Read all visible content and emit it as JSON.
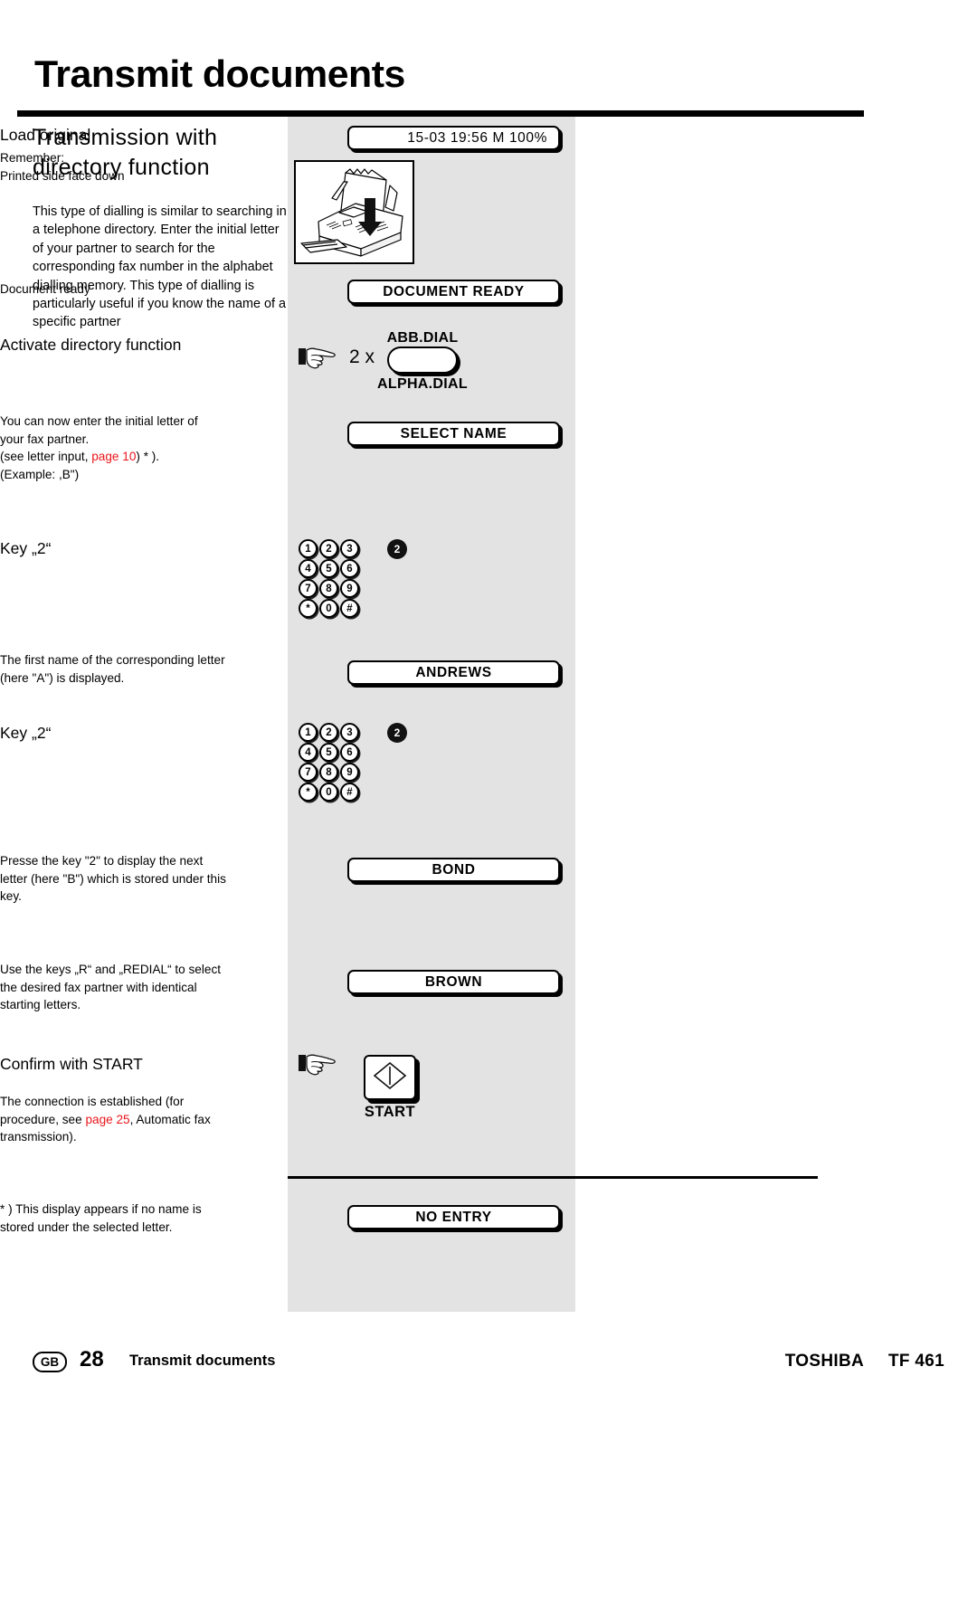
{
  "header": {
    "title": "Transmit documents"
  },
  "left_column": {
    "section_title": "Transmission with directory function",
    "paragraph": "This type of dialling is similar to searching in a telephone directory. Enter the initial letter of your partner to search for the corresponding fax number in the alphabet dialling memory. This type of dialling is particularly useful if you know the name of a specific partner"
  },
  "center_column": {
    "display_status": "15-03 19:56  M 100%",
    "display_document_ready": "DOCUMENT READY",
    "display_select_name": "SELECT NAME",
    "display_andrews": "ANDREWS",
    "display_bond": "BOND",
    "display_brown": "BROWN",
    "display_no_entry": "NO ENTRY",
    "press_count": "2 x",
    "abb_dial_label": "ABB.DIAL",
    "alpha_dial_label": "ALPHA.DIAL",
    "start_label": "START",
    "fax_illustration_alt": "fax-machine-load-original",
    "keypad_rows": [
      [
        "1",
        "2",
        "3"
      ],
      [
        "4",
        "5",
        "6"
      ],
      [
        "7",
        "8",
        "9"
      ],
      [
        "*",
        "0",
        "#"
      ]
    ],
    "keypad_highlight_1": "2",
    "keypad_highlight_2": "2"
  },
  "right_column": {
    "step1_head": "Load original",
    "step1_line1": "Remember:",
    "step1_line2": "Printed side face down",
    "step2_text": "Document ready",
    "step3_head": "Activate directory function",
    "step3_line1": "You can now enter the initial letter of",
    "step3_line2": "your fax partner.",
    "step3_line3_pre": "(see letter input, ",
    "step3_line3_link": "page 10",
    "step3_line3_post": ") * ).",
    "step3_line4": "(Example: ,B\")",
    "step4_head": "Key „2“",
    "step5_line1": "The first name of the corresponding letter",
    "step5_line2": "(here \"A\") is displayed.",
    "step6_head": "Key „2“",
    "step7_line1": "Presse the key \"2\" to display the next",
    "step7_line2": "letter (here \"B\") which is stored under this",
    "step7_line3": "key.",
    "step8_line1": "Use the keys  „R“ and „REDIAL“ to select",
    "step8_line2": "the desired fax partner with identical",
    "step8_line3": "starting letters.",
    "step9_head": "Confirm with START",
    "step9_line1": "The connection is established (for",
    "step9_line2_pre": "procedure, see ",
    "step9_line2_link": "page 25",
    "step9_line2_post": ", Automatic fax",
    "step9_line3": "transmission).",
    "footnote_line1": "* ) This display appears if no name is",
    "footnote_line2": "stored under the selected letter."
  },
  "footer": {
    "locale_badge": "GB",
    "page_number": "28",
    "section": "Transmit documents",
    "brand": "TOSHIBA",
    "model": "TF 461"
  },
  "colors": {
    "link_red": "#e8161b",
    "panel_gray": "#e3e3e3"
  }
}
